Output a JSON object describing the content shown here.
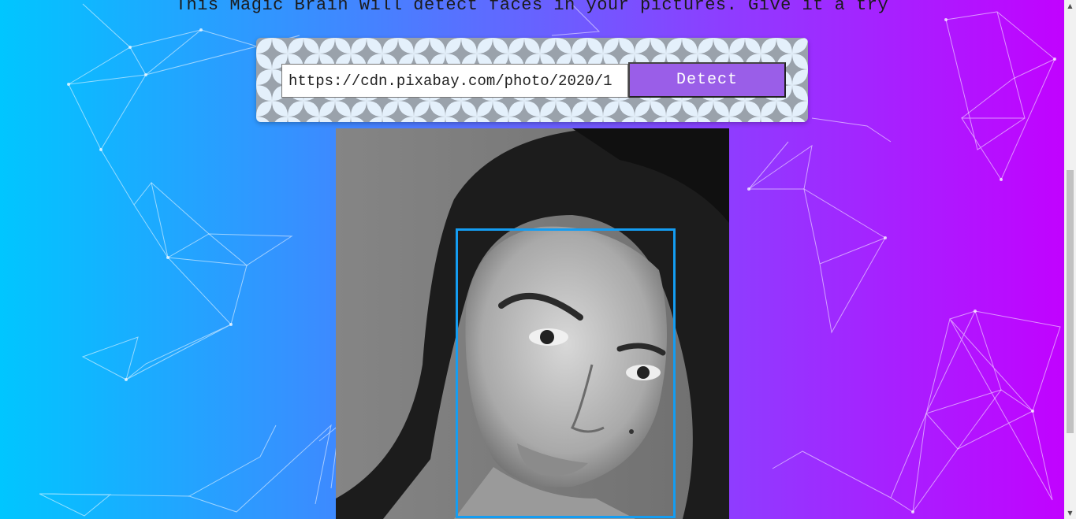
{
  "headline": "This Magic Brain will detect faces in your pictures. Give it a try",
  "url_input": {
    "value": "https://cdn.pixabay.com/photo/2020/1"
  },
  "detect_button": "Detect",
  "photo": {
    "description_icon": "portrait-photo",
    "face_box_color": "#149df2"
  },
  "colors": {
    "gradient_left": "#00c6ff",
    "gradient_right": "#c300ff",
    "button": "#9a5ee8"
  }
}
